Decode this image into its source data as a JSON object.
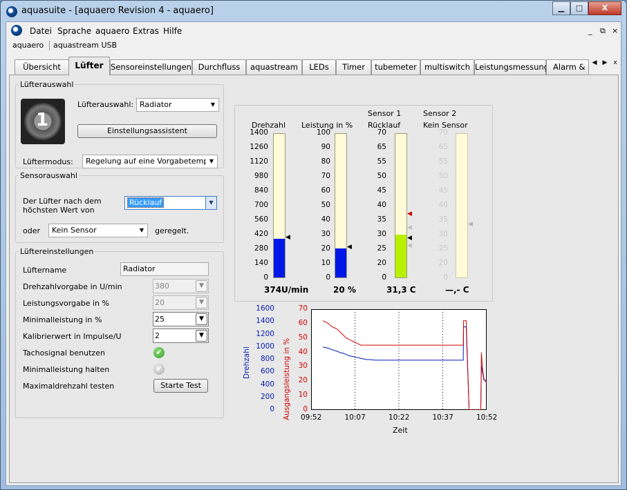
{
  "window": {
    "title": "aquasuite - [aquaero Revision 4 -  aquaero]",
    "minimize": "▁",
    "maximize": "□",
    "close": "X"
  },
  "menu": {
    "items": [
      "Datei",
      "Sprache",
      "aquaero",
      "Extras",
      "Hilfe"
    ],
    "mdi_min": "_",
    "mdi_restore": "⧉",
    "mdi_close": "×"
  },
  "devices": [
    "aquaero",
    "aquastream USB"
  ],
  "tabs": [
    "Übersicht",
    "Lüfter",
    "Sensoreinstellungen",
    "Durchfluss",
    "aquastream",
    "LEDs",
    "Timer",
    "tubemeter",
    "multiswitch",
    "Leistungsmessung",
    "Alarm & R"
  ],
  "tab_nav": {
    "left": "◀",
    "right": "▶",
    "close": "x"
  },
  "active_tab": "Lüfter",
  "fan_select": {
    "legend": "Lüfterauswahl",
    "fan_label": "Lüfterauswahl:",
    "fan_value": "Radiator",
    "fan_number": "1",
    "assistant_button": "Einstellungsassistent",
    "mode_label": "Lüftermodus:",
    "mode_value": "Regelung auf eine Vorgabetemperatı"
  },
  "sensor_select": {
    "legend": "Sensorauswahl",
    "text1": "Der Lüfter nach dem",
    "text2": "höchsten Wert von",
    "sensor1": "Rücklauf",
    "or": "oder",
    "sensor2": "Kein Sensor",
    "suffix": "geregelt."
  },
  "fan_settings": {
    "legend": "Lüftereinstellungen",
    "name_label": "Lüftername",
    "name_value": "Radiator",
    "rpm_label": "Drehzahlvorgabe in U/min",
    "rpm_value": "380",
    "power_label": "Leistungsvorgabe in %",
    "power_value": "20",
    "min_label": "Minimalleistung in %",
    "min_value": "25",
    "calib_label": "Kalibrierwert in Impulse/U",
    "calib_value": "2",
    "tacho_label": "Tachosignal benutzen",
    "tacho_on": true,
    "hold_label": "Minimalleistung halten",
    "hold_on": false,
    "test_label": "Maximaldrehzahl testen",
    "test_button": "Starte Test",
    "check_mark": "✔"
  },
  "gauges": {
    "rpm": {
      "title": "Drehzahl",
      "ticks": [
        "1400",
        "1260",
        "1120",
        "980",
        "840",
        "700",
        "560",
        "420",
        "280",
        "140",
        "0"
      ],
      "max": 1400,
      "value": 374,
      "setpoint": 380,
      "display": "374U/min",
      "color": "#0018e6"
    },
    "power": {
      "title": "Leistung in %",
      "ticks": [
        "100",
        "90",
        "80",
        "70",
        "60",
        "50",
        "40",
        "30",
        "20",
        "10",
        "0"
      ],
      "max": 100,
      "value": 20,
      "setpoint": 20,
      "display": "20 %",
      "color": "#0018e6"
    },
    "sensor1": {
      "title1": "Sensor 1",
      "title2": "Rücklauf",
      "ticks": [
        "70",
        "65",
        "55",
        "50",
        "45",
        "40",
        "35",
        "30",
        "25",
        "20",
        "0"
      ],
      "value": 31.3,
      "display": "31,3 C",
      "color": "#b8f000"
    },
    "sensor2": {
      "title1": "Sensor 2",
      "title2": "Kein Sensor",
      "ticks": [
        "70",
        "65",
        "55",
        "50",
        "45",
        "40",
        "35",
        "30",
        "25",
        "20",
        "0"
      ],
      "display": "—,- C"
    }
  },
  "chart_data": {
    "type": "line",
    "xlabel": "Zeit",
    "ylabel_left": "Drehzahl",
    "ylabel_right": "Ausgangsleistung in %",
    "x_ticks": [
      "09:52",
      "10:07",
      "10:22",
      "10:37",
      "10:52"
    ],
    "yleft_ticks": [
      "1600",
      "1400",
      "1200",
      "1000",
      "800",
      "600",
      "400",
      "200",
      "0"
    ],
    "yright_ticks": [
      "70",
      "60",
      "50",
      "40",
      "30",
      "20",
      "10",
      "0"
    ],
    "yleft_range": [
      0,
      1600
    ],
    "yright_range": [
      0,
      70
    ],
    "x_range_minutes": [
      0,
      60
    ],
    "series": [
      {
        "axis": "left",
        "color": "#0018b0",
        "x": [
          4,
          5,
          6,
          7,
          8,
          9,
          10,
          11,
          12,
          13,
          14,
          15,
          16,
          17,
          18,
          19,
          20,
          21,
          22,
          24,
          26,
          28,
          30,
          33,
          36,
          40,
          44,
          48,
          52,
          52.1,
          53,
          54,
          55,
          56,
          57,
          58,
          58.2,
          58.5,
          59,
          59.5,
          60
        ],
        "y": [
          1000,
          990,
          980,
          960,
          945,
          930,
          910,
          900,
          880,
          860,
          850,
          840,
          830,
          820,
          810,
          800,
          800,
          795,
          790,
          790,
          790,
          790,
          790,
          790,
          790,
          790,
          790,
          790,
          790,
          1320,
          1320,
          0,
          0,
          0,
          0,
          0,
          700,
          620,
          480,
          470,
          460
        ]
      },
      {
        "axis": "right",
        "color": "#d00000",
        "x": [
          4,
          5,
          6,
          7,
          8,
          9,
          10,
          11,
          12,
          13,
          14,
          15,
          16,
          17,
          18,
          19,
          20,
          21,
          22,
          24,
          26,
          28,
          30,
          33,
          36,
          40,
          44,
          48,
          52,
          52.1,
          53,
          54,
          55,
          56,
          57,
          58,
          58.2,
          58.5,
          59,
          59.5,
          60
        ],
        "y": [
          62,
          61,
          60,
          58,
          57,
          56,
          54,
          52,
          50,
          49,
          48,
          47,
          46,
          45,
          45,
          45,
          45,
          45,
          45,
          45,
          45,
          45,
          45,
          45,
          45,
          45,
          45,
          45,
          45,
          62,
          62,
          0,
          0,
          0,
          0,
          0,
          40,
          30,
          22,
          20,
          19
        ]
      }
    ]
  }
}
